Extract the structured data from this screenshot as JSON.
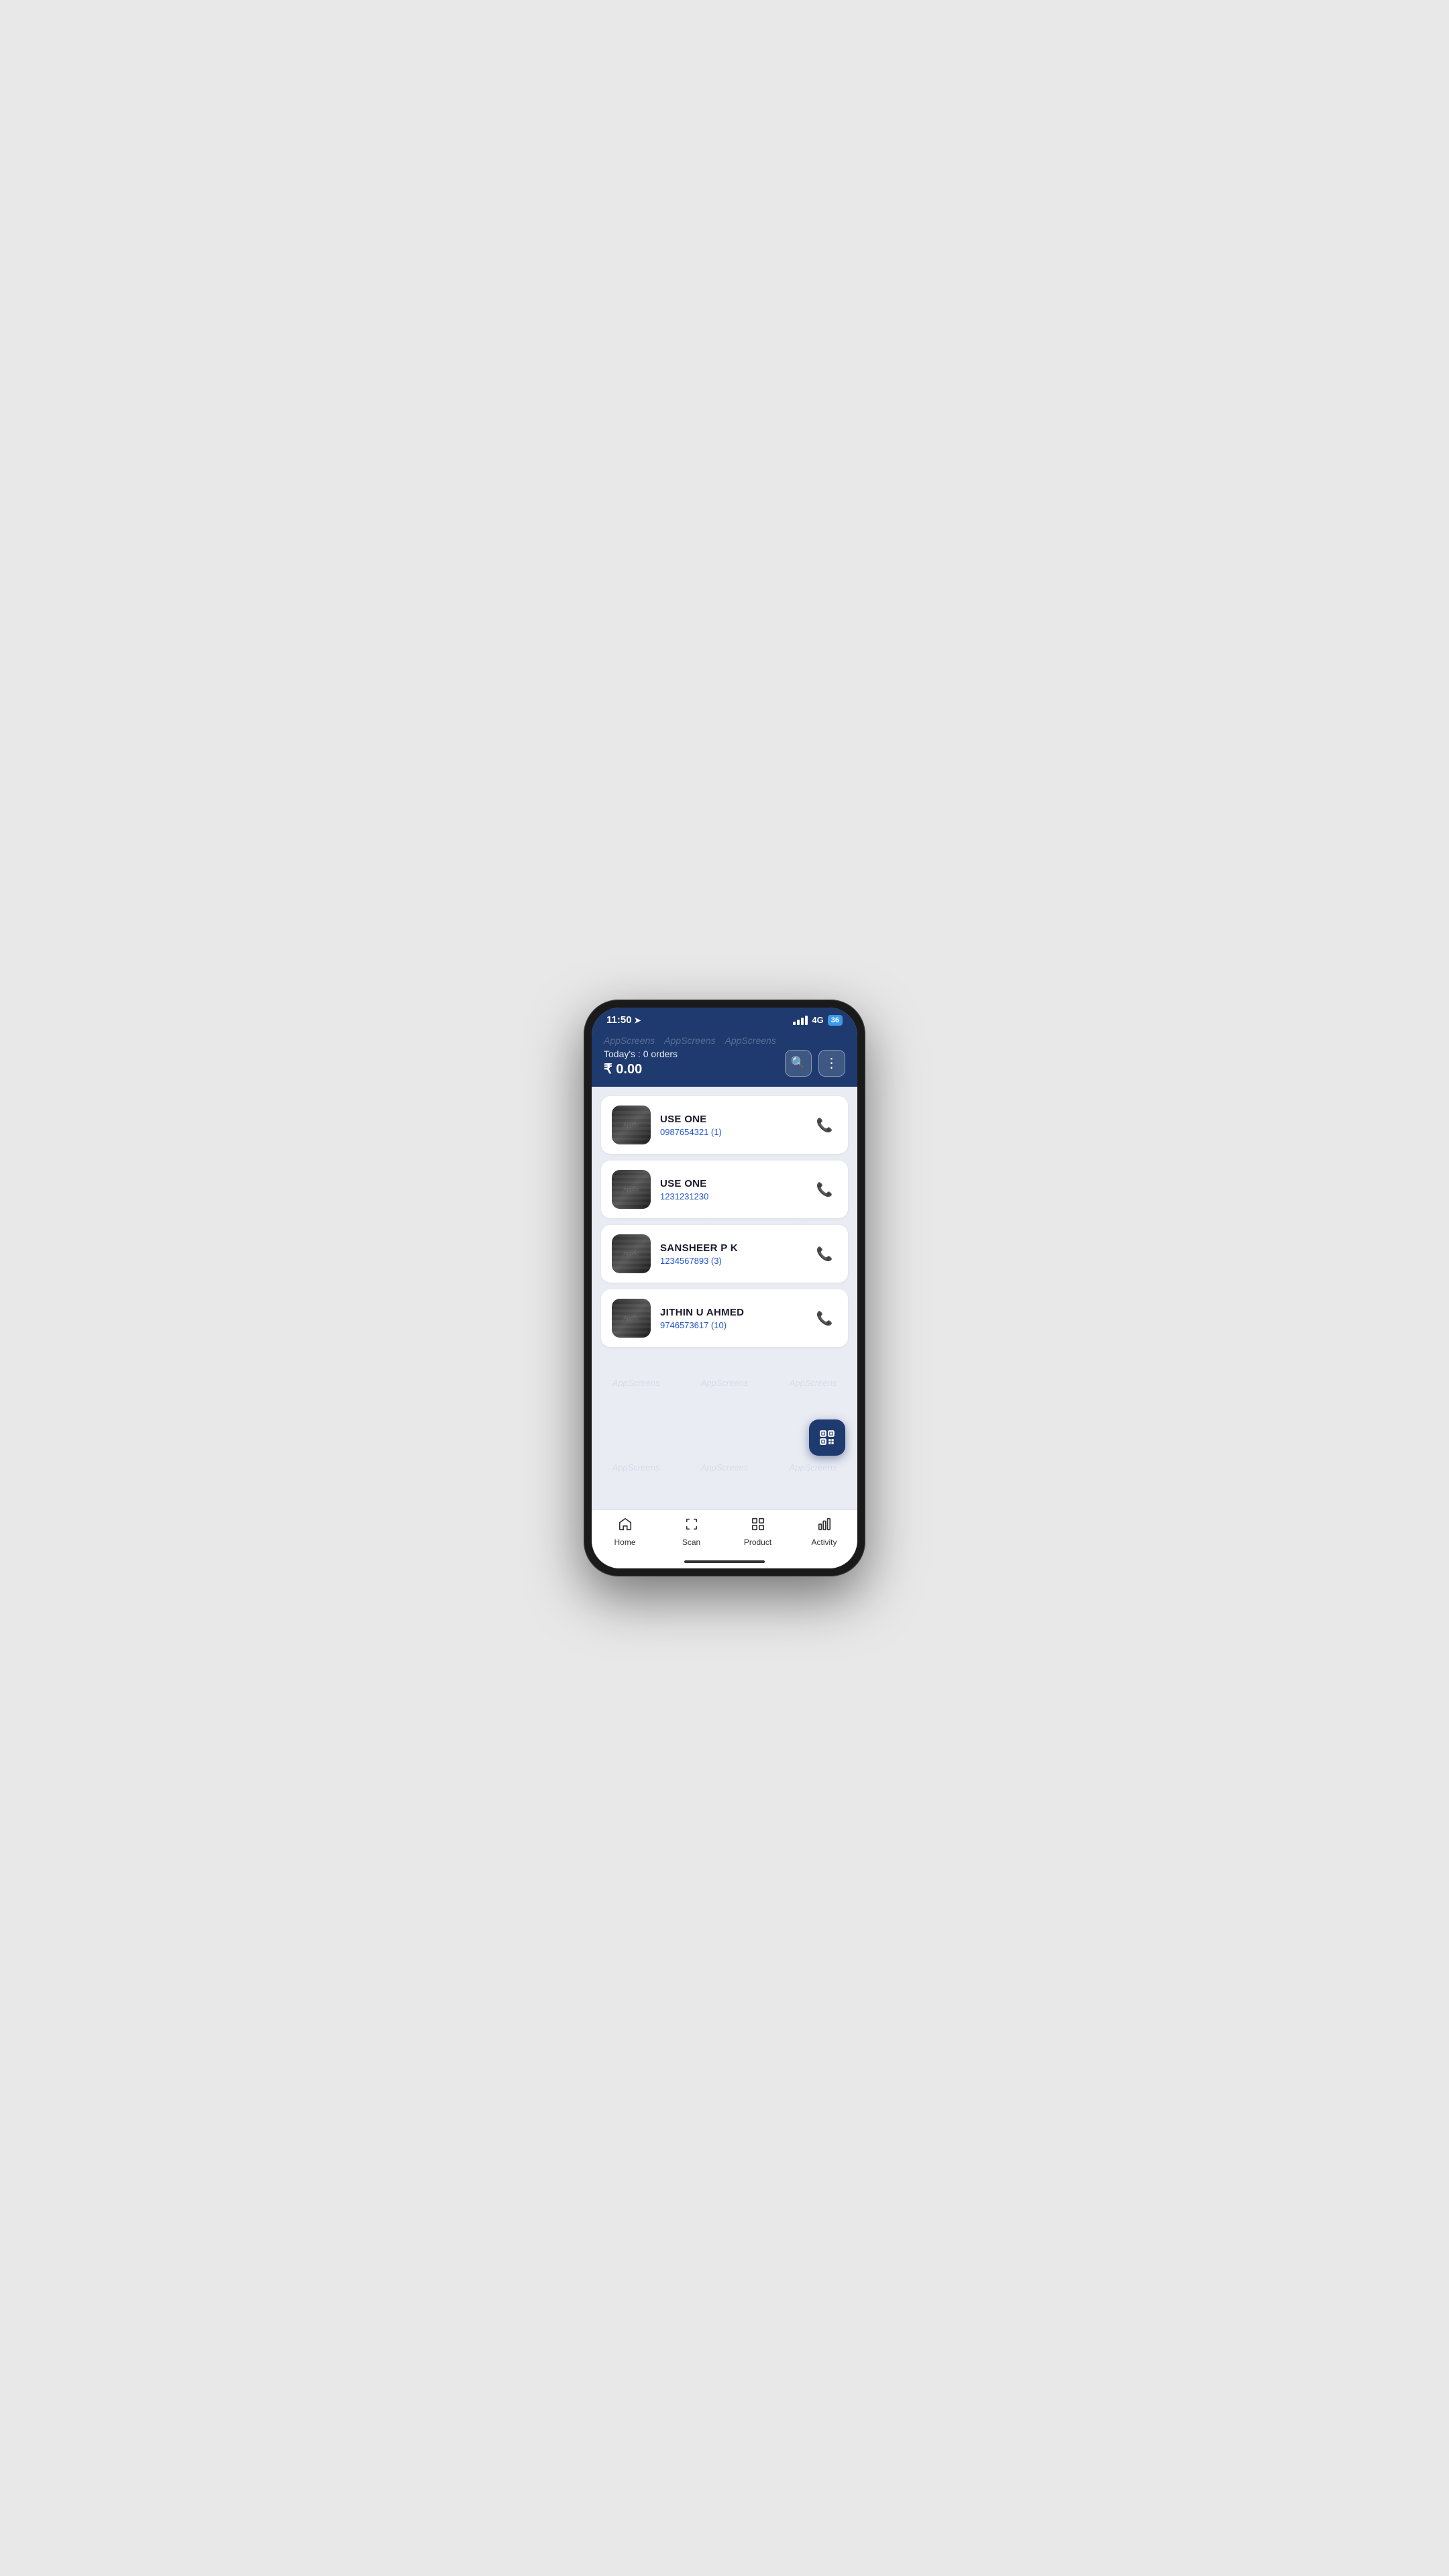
{
  "phone": {
    "status_bar": {
      "time": "11:50",
      "network": "4G",
      "battery": "36"
    },
    "header": {
      "watermarks": [
        "AppScreens",
        "AppScreens",
        "AppScreens"
      ],
      "today_label": "Today's : 0 orders",
      "amount": "₹ 0.00",
      "search_btn_icon": "🔍",
      "more_btn_icon": "⋮"
    },
    "customers": [
      {
        "name": "USE ONE",
        "phone": "0987654321 (1)"
      },
      {
        "name": "USE ONE",
        "phone": "1231231230"
      },
      {
        "name": "SANSHEER P K",
        "phone": "1234567893 (3)"
      },
      {
        "name": "JITHIN U AHMED",
        "phone": "9746573617 (10)"
      }
    ],
    "nav": {
      "items": [
        {
          "label": "Home",
          "icon": "🏠"
        },
        {
          "label": "Scan",
          "icon": "⬜"
        },
        {
          "label": "Product",
          "icon": "⊞"
        },
        {
          "label": "Activity",
          "icon": "📊"
        }
      ]
    },
    "fab": {
      "icon": "⊞"
    }
  }
}
